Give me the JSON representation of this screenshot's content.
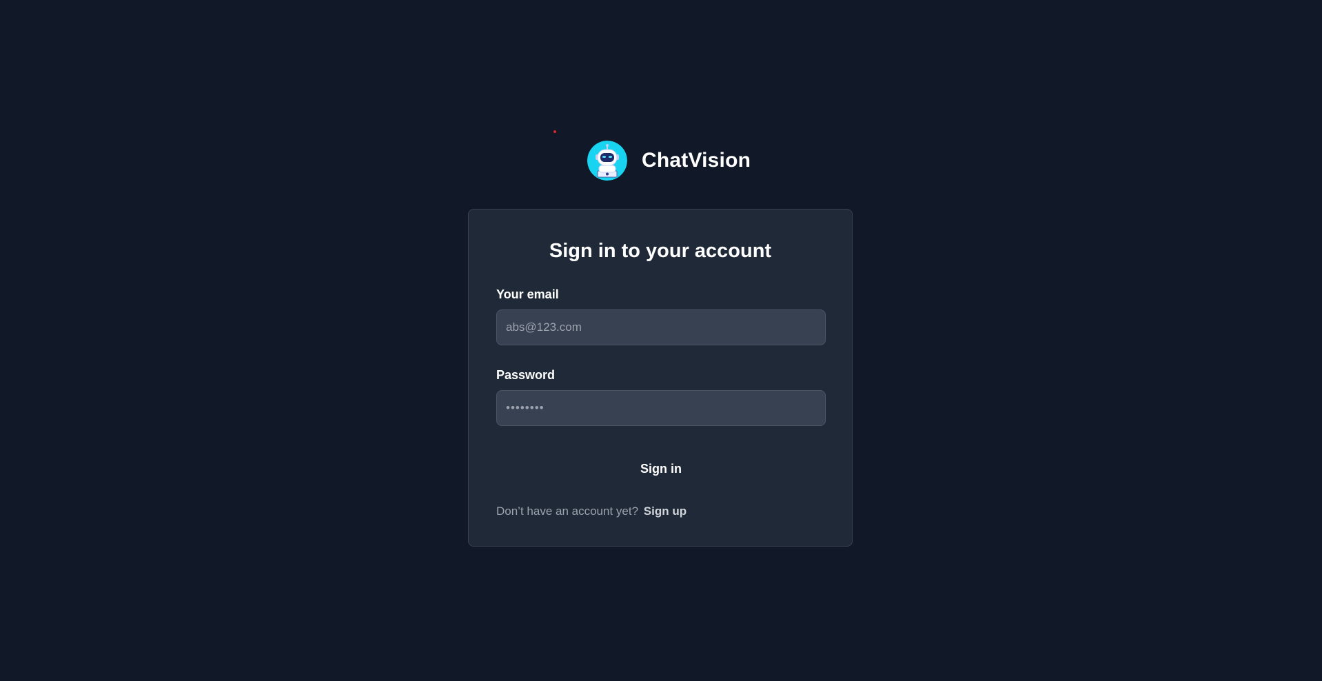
{
  "brand": {
    "name": "ChatVision",
    "logo_icon": "robot-icon"
  },
  "login": {
    "title": "Sign in to your account",
    "email_label": "Your email",
    "email_placeholder": "abs@123.com",
    "password_label": "Password",
    "password_placeholder": "••••••••",
    "submit_label": "Sign in",
    "signup_prompt": "Don’t have an account yet?",
    "signup_link": "Sign up"
  },
  "colors": {
    "background": "#111827",
    "card": "#1f2937",
    "input": "#374151",
    "logo_accent": "#19d4f0",
    "marker": "#dc2626"
  }
}
